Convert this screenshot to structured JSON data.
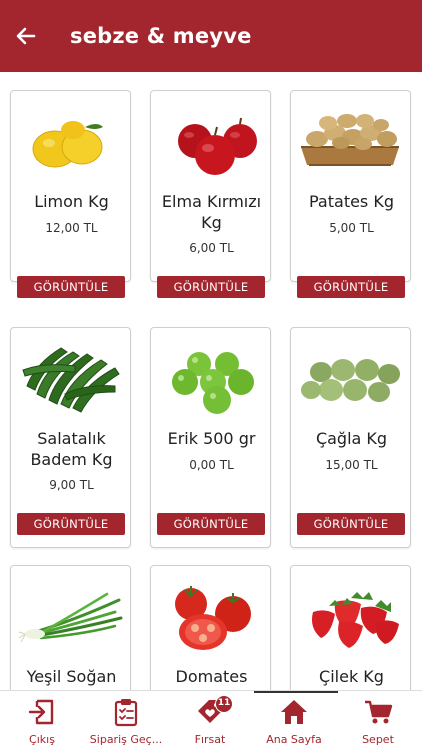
{
  "header": {
    "title": "sebze & meyve"
  },
  "products": [
    {
      "name": "Limon Kg",
      "price": "12,00 TL",
      "button": "GÖRÜNTÜLE",
      "icon": "lemon-image"
    },
    {
      "name": "Elma Kırmızı Kg",
      "price": "6,00 TL",
      "button": "GÖRÜNTÜLE",
      "icon": "apple-image"
    },
    {
      "name": "Patates Kg",
      "price": "5,00 TL",
      "button": "GÖRÜNTÜLE",
      "icon": "potato-image"
    },
    {
      "name": "Salatalık Badem Kg",
      "price": "9,00 TL",
      "button": "GÖRÜNTÜLE",
      "icon": "cucumber-image"
    },
    {
      "name": "Erik 500 gr",
      "price": "0,00 TL",
      "button": "GÖRÜNTÜLE",
      "icon": "plum-image"
    },
    {
      "name": "Çağla Kg",
      "price": "15,00 TL",
      "button": "GÖRÜNTÜLE",
      "icon": "green-almond-image"
    },
    {
      "name": "Yeşil Soğan",
      "price": "",
      "button": "",
      "icon": "green-onion-image"
    },
    {
      "name": "Domates",
      "price": "",
      "button": "",
      "icon": "tomato-image"
    },
    {
      "name": "Çilek Kg",
      "price": "",
      "button": "",
      "icon": "strawberry-image"
    }
  ],
  "nav": {
    "items": [
      {
        "label": "Çıkış",
        "icon": "logout-icon"
      },
      {
        "label": "Sipariş Geç...",
        "icon": "clipboard-icon"
      },
      {
        "label": "Fırsat",
        "icon": "tag-heart-icon",
        "badge": "11"
      },
      {
        "label": "Ana Sayfa",
        "icon": "home-icon",
        "active": true
      },
      {
        "label": "Sepet",
        "icon": "cart-icon"
      }
    ]
  },
  "colors": {
    "primary": "#a3262e",
    "background": "#ffffff"
  }
}
